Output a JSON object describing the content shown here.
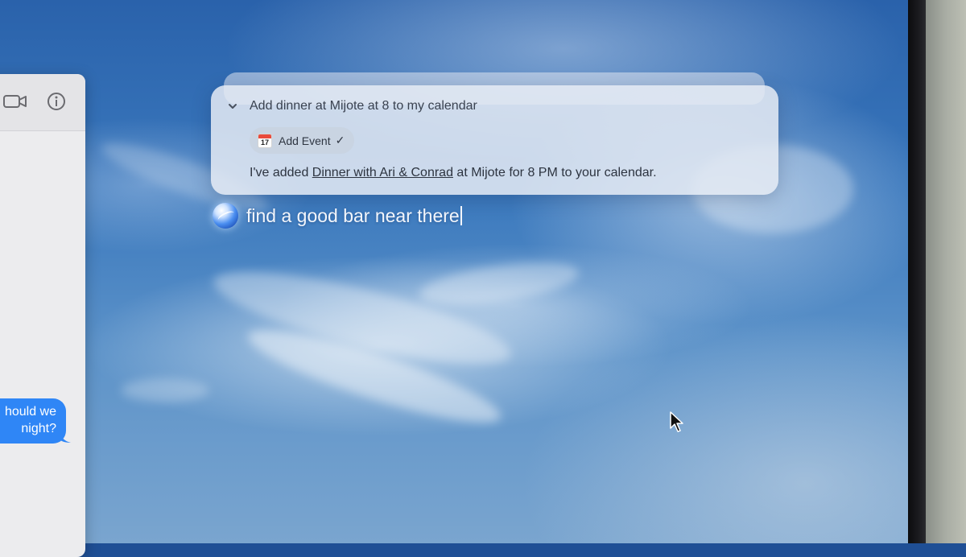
{
  "siri": {
    "query": "Add dinner at Mijote at 8 to my calendar",
    "action_chip": {
      "icon": "calendar-icon",
      "date_number": "17",
      "label": "Add Event",
      "check": "✓"
    },
    "response": {
      "prefix": "I've added ",
      "link_text": "Dinner with Ari & Conrad",
      "suffix": " at Mijote for 8 PM to your calendar."
    },
    "input_text": "find a good bar near there"
  },
  "messages": {
    "toolbar_icons": [
      "video-camera-icon",
      "info-icon"
    ],
    "bubble_lines": [
      "hould we",
      "night?"
    ],
    "bubble_color": "#2f86f6"
  },
  "colors": {
    "panel_bg": "#e4eaf3",
    "text_primary": "#2d3440"
  }
}
